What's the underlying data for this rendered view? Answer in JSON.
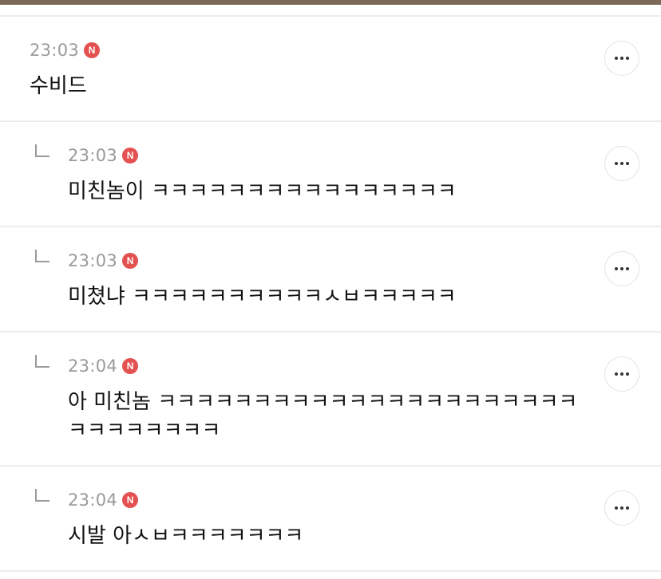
{
  "comments": [
    {
      "time": "23:03",
      "badge": "N",
      "text": "수비드",
      "is_reply": false
    },
    {
      "time": "23:03",
      "badge": "N",
      "text": "미친놈이 ㅋㅋㅋㅋㅋㅋㅋㅋㅋㅋㅋㅋㅋㅋㅋㅋ",
      "is_reply": true
    },
    {
      "time": "23:03",
      "badge": "N",
      "text": "미쳤냐 ㅋㅋㅋㅋㅋㅋㅋㅋㅋㅋㅅㅂㅋㅋㅋㅋㅋ",
      "is_reply": true
    },
    {
      "time": "23:04",
      "badge": "N",
      "text": "아 미친놈 ㅋㅋㅋㅋㅋㅋㅋㅋㅋㅋㅋㅋㅋㅋㅋㅋㅋㅋㅋㅋㅋㅋ",
      "text2": "ㅋㅋㅋㅋㅋㅋㅋㅋ",
      "is_reply": true
    },
    {
      "time": "23:04",
      "badge": "N",
      "text": "시발 아ㅅㅂㅋㅋㅋㅋㅋㅋㅋ",
      "is_reply": true
    }
  ],
  "icons": {
    "more": "more-dots-icon",
    "reply": "reply-arrow-icon",
    "new": "new-badge-icon"
  },
  "colors": {
    "top_bar": "#7a6a57",
    "badge": "#e45151",
    "time": "#9a9a9a",
    "text": "#111111"
  }
}
